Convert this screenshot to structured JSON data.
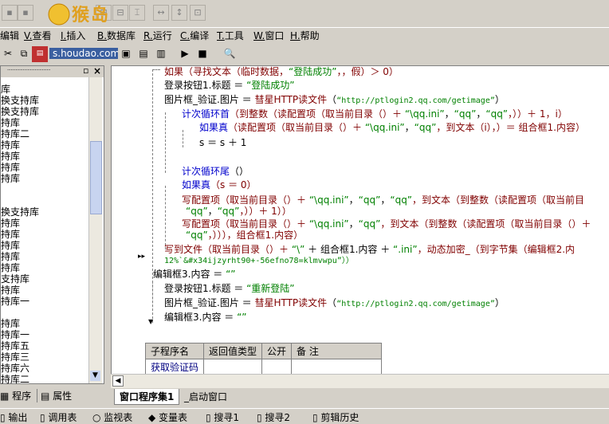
{
  "logo_text": "s.houdao.com",
  "menu": [
    {
      "key": "",
      "label": "编辑"
    },
    {
      "key": "V.",
      "label": "查看"
    },
    {
      "key": "I.",
      "label": "插入"
    },
    {
      "key": "B.",
      "label": "数据库"
    },
    {
      "key": "R.",
      "label": "运行"
    },
    {
      "key": "C.",
      "label": "编译"
    },
    {
      "key": "T.",
      "label": "工具"
    },
    {
      "key": "W.",
      "label": "窗口"
    },
    {
      "key": "H.",
      "label": "帮助"
    }
  ],
  "tree": [
    "库",
    "换支持库",
    "换支持库",
    "持库",
    "持库二",
    "持库",
    "持库",
    "持库",
    "持库",
    "",
    "",
    "换支持库",
    "持库",
    "持库",
    "持库",
    "持库",
    "持库",
    "支持库",
    "持库",
    "持库一",
    "",
    "持库",
    "持库一",
    "持库五",
    "持库三",
    "持库六",
    "持库二"
  ],
  "left_tabs": {
    "program": "程序",
    "property": "属性"
  },
  "code": {
    "l1": {
      "fn": "如果",
      "rest": "（寻找文本（临时数据，",
      "str": "“登陆成功”",
      "tail": "，，假）＞ 0）"
    },
    "l2": {
      "a": "登录按钮1.标题 ＝ ",
      "str": "“登陆成功”"
    },
    "l3": {
      "a": "图片框_验证.图片 ＝ ",
      "fn": "彗星HTTP读文件",
      "b": "（",
      "str": "“http://ptlogin2.qq.com/getimage”",
      "c": "）"
    },
    "l4": {
      "fn": "计次循环首",
      "rest": "（到整数（读配置项（取当前目录（）＋ ",
      "s1": "“\\qq.ini”",
      "mid": "，",
      "s2": "“qq”",
      "mid2": "，",
      "s3": "“qq”",
      "tail": "，））＋ 1，i）"
    },
    "l5": {
      "fn": "如果真",
      "rest": "（读配置项（取当前目录（）＋ ",
      "s1": "“\\qq.ini”",
      "mid": "，",
      "s2": "“qq”",
      "tail": "，到文本（i），）＝ 组合框1.内容）"
    },
    "l6": "s ＝ s ＋ 1",
    "l7": {
      "fn": "计次循环尾",
      "rest": "（）"
    },
    "l8": {
      "fn": "如果真",
      "rest": "（s ＝ 0）"
    },
    "l9": {
      "fn": "写配置项",
      "rest": "（取当前目录（）＋ ",
      "s1": "“\\qq.ini”",
      "m1": "，",
      "s2": "“qq”",
      "m2": "，",
      "s3": "“qq”",
      "tail": "，到文本（到整数（读配置项（取当前目"
    },
    "l10": {
      "s1": "“qq”",
      "m1": "，",
      "s2": "“qq”",
      "tail": "，））＋ 1））"
    },
    "l11": {
      "fn": "写配置项",
      "rest": "（取当前目录（）＋ ",
      "s1": "“\\qq.ini”",
      "m1": "，",
      "s2": "“qq”",
      "tail": "，到文本（到整数（读配置项（取当前目录（）＋"
    },
    "l12": {
      "s1": "“qq”",
      "tail": "，））），组合框1.内容）"
    },
    "l13": {
      "fn": "写到文件",
      "rest": "（取当前目录（）＋ ",
      "s1": "“\\”",
      "m1": " ＋ 组合框1.内容 ＋ ",
      "s2": "“.ini”",
      "tail": "，动态加密_（到字节集（编辑框2.内"
    },
    "l14": "12%`&#x34ijzyrht90+-56efno78=klmvwpu”））",
    "l15": {
      "a": "编辑框3.内容 ＝ ",
      "str": "“”"
    },
    "l16": {
      "a": "登录按钮1.标题 ＝ ",
      "str": "“重新登陆”"
    },
    "l17": {
      "a": "图片框_验证.图片 ＝ ",
      "fn": "彗星HTTP读文件",
      "b": "（",
      "str": "“http://ptlogin2.qq.com/getimage”",
      "c": "）"
    },
    "l18": {
      "a": "编辑框3.内容 ＝ ",
      "str": "“”"
    }
  },
  "subprog_table": {
    "headers": [
      "子程序名",
      "返回值类型",
      "公开",
      "备 注"
    ],
    "rows": [
      [
        "获取验证码",
        "",
        "",
        ""
      ]
    ]
  },
  "editor_tabs": {
    "active": "窗口程序集1",
    "other": "_启动窗口"
  },
  "bottom_tabs": [
    "输出",
    "调用表",
    "监视表",
    "变量表",
    "搜寻1",
    "搜寻2",
    "剪辑历史"
  ]
}
